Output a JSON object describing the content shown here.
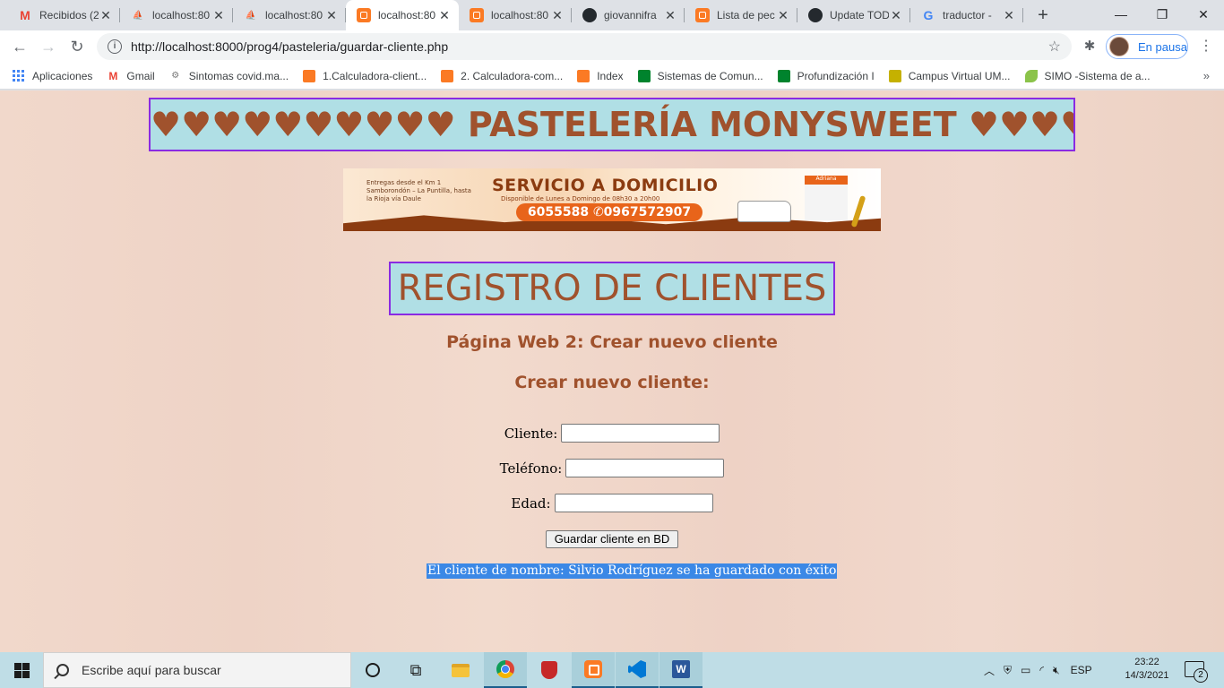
{
  "browser": {
    "tabs": [
      {
        "title": "Recibidos (2",
        "icon": "gmail-icon"
      },
      {
        "title": "localhost:80",
        "icon": "phpmyadmin-icon"
      },
      {
        "title": "localhost:80",
        "icon": "phpmyadmin-icon"
      },
      {
        "title": "localhost:80",
        "icon": "xampp-icon",
        "active": true
      },
      {
        "title": "localhost:80",
        "icon": "xampp-icon"
      },
      {
        "title": "giovannifra",
        "icon": "github-icon"
      },
      {
        "title": "Lista de pec",
        "icon": "xampp-icon"
      },
      {
        "title": "Update TOD",
        "icon": "github-icon"
      },
      {
        "title": "traductor -",
        "icon": "google-icon"
      }
    ],
    "url": "http://localhost:8000/prog4/pasteleria/guardar-cliente.php",
    "profile_status": "En pausa",
    "bookmarks": [
      {
        "label": "Aplicaciones",
        "icon": "apps-grid-icon"
      },
      {
        "label": "Gmail",
        "icon": "gmail-icon"
      },
      {
        "label": "Sintomas covid.ma...",
        "icon": "seal-icon"
      },
      {
        "label": "1.Calculadora-client...",
        "icon": "xampp-icon"
      },
      {
        "label": "2. Calculadora-com...",
        "icon": "xampp-icon"
      },
      {
        "label": "Index",
        "icon": "xampp-icon"
      },
      {
        "label": "Sistemas de Comun...",
        "icon": "meet-icon"
      },
      {
        "label": "Profundización I",
        "icon": "meet-icon"
      },
      {
        "label": "Campus Virtual UM...",
        "icon": "campus-icon"
      },
      {
        "label": "SIMO -Sistema de a...",
        "icon": "leaf-icon"
      }
    ]
  },
  "page": {
    "banner_title": "♥♥♥♥♥♥♥♥♥♥ PASTELERÍA MONYSWEET ♥♥♥♥♥♥♥♥♥",
    "promo": {
      "small_text": "Entregas desde el Km 1 Samborondón – La Puntilla, hasta la Rioja vía Daule",
      "headline": "SERVICIO A DOMICILIO",
      "subline": "Disponible de Lunes a Domingo de 08h30 a 20h00",
      "phones": "6055588 ✆0967572907",
      "shop_sign": "Adriana"
    },
    "register_title": "REGISTRO DE CLIENTES",
    "subtitle": "Página Web 2: Crear nuevo cliente",
    "form_heading": "Crear nuevo cliente:",
    "form": {
      "cliente_label": "Cliente:",
      "cliente_value": "",
      "telefono_label": "Teléfono:",
      "telefono_value": "",
      "edad_label": "Edad:",
      "edad_value": "",
      "submit_label": "Guardar cliente en BD"
    },
    "success_message": "El cliente de nombre: Silvio Rodríguez se ha guardado con éxito",
    "colors": {
      "title_text": "#a0522d",
      "title_bg": "#b0dfe5",
      "title_border": "#8a2be2",
      "selection": "#3b88e6"
    }
  },
  "taskbar": {
    "search_placeholder": "Escribe aquí para buscar",
    "language": "ESP",
    "time": "23:22",
    "date": "14/3/2021",
    "notification_count": "2"
  }
}
